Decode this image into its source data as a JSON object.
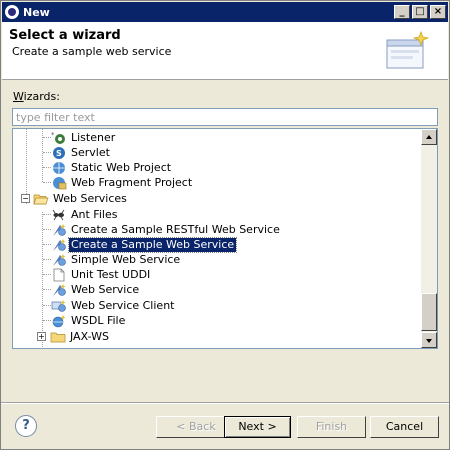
{
  "window": {
    "title": "New"
  },
  "header": {
    "heading": "Select a wizard",
    "subtitle": "Create a sample web service"
  },
  "wizards": {
    "label_prefix": "W",
    "label_rest": "izards:",
    "filter_placeholder": "type filter text",
    "items": [
      {
        "label": "Listener",
        "icon": "servlet-listener-icon"
      },
      {
        "label": "Servlet",
        "icon": "servlet-icon"
      },
      {
        "label": "Static Web Project",
        "icon": "web-project-icon"
      },
      {
        "label": "Web Fragment Project",
        "icon": "web-fragment-icon"
      },
      {
        "label": "Web Services",
        "icon": "folder-open-icon",
        "expanded": true
      },
      {
        "label": "Ant Files",
        "icon": "ant-icon"
      },
      {
        "label": "Create a Sample RESTful Web Service",
        "icon": "web-service-wizard-icon"
      },
      {
        "label": "Create a Sample Web Service",
        "icon": "web-service-wizard-icon",
        "selected": true
      },
      {
        "label": "Simple Web Service",
        "icon": "web-service-wizard-icon"
      },
      {
        "label": "Unit Test UDDI",
        "icon": "document-icon"
      },
      {
        "label": "Web Service",
        "icon": "web-service-wizard-icon"
      },
      {
        "label": "Web Service Client",
        "icon": "web-service-client-icon"
      },
      {
        "label": "WSDL File",
        "icon": "wsdl-icon"
      },
      {
        "label": "JAX-WS",
        "icon": "folder-icon",
        "expanded": false
      }
    ]
  },
  "buttons": {
    "help": "?",
    "back": "< Back",
    "next": "Next >",
    "finish": "Finish",
    "cancel": "Cancel"
  },
  "colors": {
    "title_bar": "#0a246a",
    "selection": "#0a246a",
    "dialog_bg": "#ece9d8"
  }
}
